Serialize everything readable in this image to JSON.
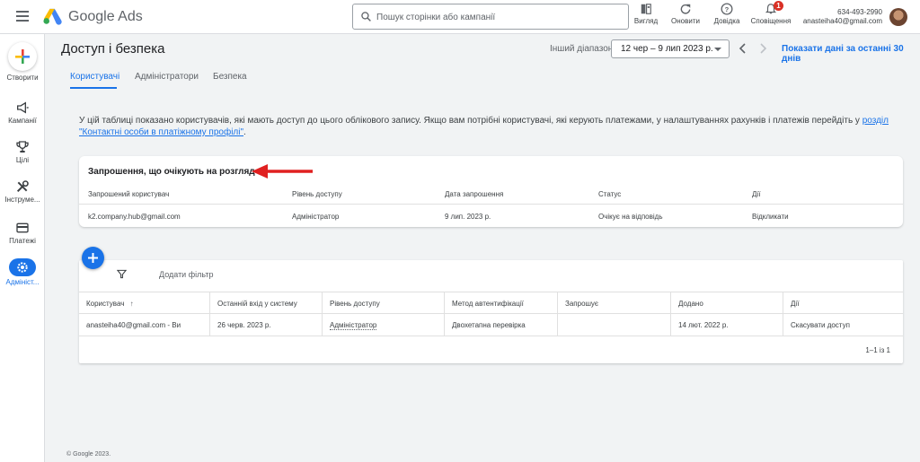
{
  "topbar": {
    "brand": "Google Ads",
    "search_placeholder": "Пошук сторінки або кампанії",
    "buttons": [
      {
        "label": "Вигляд",
        "icon": "appearance-icon"
      },
      {
        "label": "Оновити",
        "icon": "refresh-icon"
      },
      {
        "label": "Довідка",
        "icon": "help-icon"
      },
      {
        "label": "Сповіщення",
        "icon": "bell-icon"
      }
    ],
    "notification_count": "1",
    "account_id": "634-493-2990",
    "account_email": "anasteiha40@gmail.com"
  },
  "leftnav": {
    "create_label": "Створити",
    "items": [
      {
        "label": "Кампанії",
        "icon": "megaphone-icon"
      },
      {
        "label": "Цілі",
        "icon": "trophy-icon"
      },
      {
        "label": "Інструме...",
        "icon": "tools-icon"
      },
      {
        "label": "Платежі",
        "icon": "credit-card-icon"
      },
      {
        "label": "Адмініст...",
        "icon": "admin-gear-icon",
        "active": true
      }
    ]
  },
  "header": {
    "title": "Доступ і безпека",
    "range_label": "Інший діапазон",
    "date_range": "12 чер – 9 лип 2023 р.",
    "last_30_days": "Показати дані за останні 30 днів"
  },
  "tabs": [
    "Користувачі",
    "Адміністратори",
    "Безпека"
  ],
  "intro": {
    "text": "У цій таблиці показано користувачів, які мають доступ до цього облікового запису. Якщо вам потрібні користувачі, які керують платежами, у налаштуваннях рахунків і платежів перейдіть у ",
    "link": "розділ \"Контактні особи в платіжному профілі\"",
    "suffix": "."
  },
  "pending": {
    "title": "Запрошення, що очікують на розгляд",
    "columns": [
      "Запрошений користувач",
      "Рівень доступу",
      "Дата запрошення",
      "Статус",
      "Дії"
    ],
    "row": {
      "user": "k2.company.hub@gmail.com",
      "access": "Адміністратор",
      "date": "9 лип. 2023 р.",
      "status": "Очікує на відповідь",
      "action": "Відкликати"
    }
  },
  "users": {
    "add_filter": "Додати фільтр",
    "columns": [
      "Користувач",
      "Останній вхід у систему",
      "Рівень доступу",
      "Метод автентифікації",
      "Запрошує",
      "Додано",
      "Дії"
    ],
    "sort_arrow": "↑",
    "row": {
      "user": "anasteiha40@gmail.com - Ви",
      "last_login": "26 черв. 2023 р.",
      "access": "Адміністратор",
      "auth": "Двохетапна перевірка",
      "invited_by": "",
      "added": "14 лют. 2022 р.",
      "action": "Скасувати доступ"
    },
    "pagination": "1–1 із 1"
  },
  "footer": "© Google 2023.",
  "colors": {
    "accent": "#1a73e8",
    "arrow": "#e02020"
  }
}
